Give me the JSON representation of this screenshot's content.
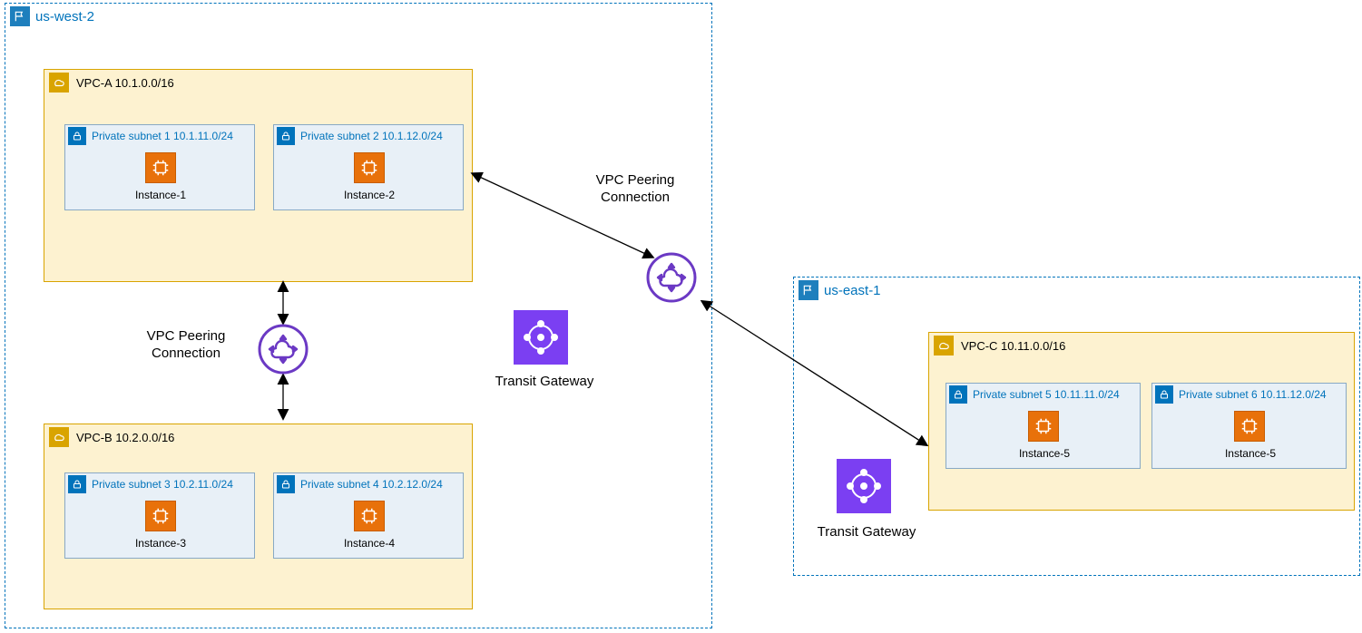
{
  "regions": {
    "west": {
      "name": "us-west-2"
    },
    "east": {
      "name": "us-east-1"
    }
  },
  "vpcs": {
    "a": {
      "label": "VPC-A 10.1.0.0/16"
    },
    "b": {
      "label": "VPC-B 10.2.0.0/16"
    },
    "c": {
      "label": "VPC-C 10.11.0.0/16"
    }
  },
  "subnets": {
    "s1": {
      "label": "Private subnet 1 10.1.11.0/24",
      "instance": "Instance-1"
    },
    "s2": {
      "label": "Private subnet 2 10.1.12.0/24",
      "instance": "Instance-2"
    },
    "s3": {
      "label": "Private subnet 3 10.2.11.0/24",
      "instance": "Instance-3"
    },
    "s4": {
      "label": "Private subnet 4 10.2.12.0/24",
      "instance": "Instance-4"
    },
    "s5": {
      "label": "Private subnet 5 10.11.11.0/24",
      "instance": "Instance-5"
    },
    "s6": {
      "label": "Private subnet 6 10.11.12.0/24",
      "instance": "Instance-5"
    }
  },
  "labels": {
    "peering1": "VPC Peering\nConnection",
    "peering2": "VPC Peering\nConnection",
    "tgw1": "Transit Gateway",
    "tgw2": "Transit Gateway"
  }
}
